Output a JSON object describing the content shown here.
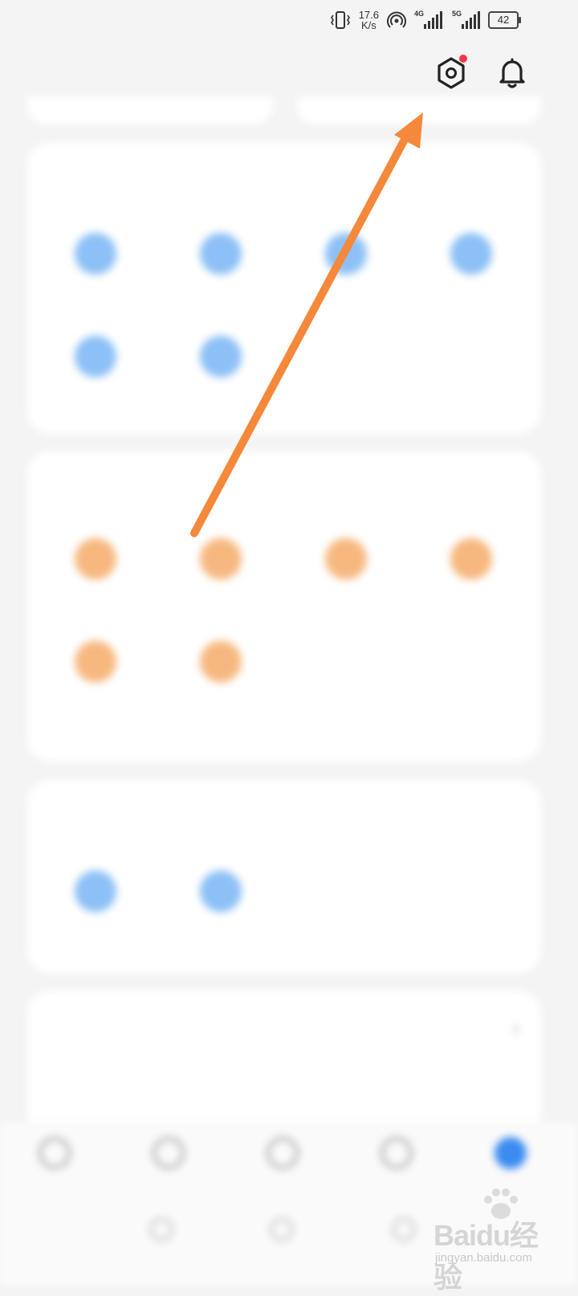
{
  "status_bar": {
    "time": "",
    "net_speed_value": "17.6",
    "net_speed_unit": "K/s",
    "signal1_tag": "4G",
    "signal2_tag": "5G",
    "battery": "42"
  },
  "header": {
    "settings_icon": "gear-icon",
    "settings_badge_color": "#f03a4b",
    "notifications_icon": "bell-icon"
  },
  "sections": [
    {
      "title": "",
      "items": [
        {
          "label": "",
          "icon_color": "#8cc0f6"
        },
        {
          "label": "",
          "icon_color": "#8cc0f6"
        },
        {
          "label": "",
          "icon_color": "#8cc0f6"
        },
        {
          "label": "",
          "icon_color": "#8cc0f6"
        },
        {
          "label": "",
          "icon_color": "#8cc0f6"
        },
        {
          "label": "",
          "icon_color": "#8cc0f6"
        }
      ]
    },
    {
      "title": "",
      "items": [
        {
          "label": "",
          "icon_color": "#f7b880"
        },
        {
          "label": "",
          "icon_color": "#f7b880"
        },
        {
          "label": "",
          "icon_color": "#f7b880"
        },
        {
          "label": "",
          "icon_color": "#f7b880"
        },
        {
          "label": "",
          "icon_color": "#f7b880"
        },
        {
          "label": "",
          "icon_color": "#f7b880"
        }
      ]
    },
    {
      "title": "",
      "items": [
        {
          "label": "",
          "icon_color": "#8cc0f6"
        },
        {
          "label": "",
          "icon_color": "#8cc0f6"
        }
      ]
    }
  ],
  "list_rows": [
    "",
    ""
  ],
  "bottom_nav": [
    "",
    "",
    "",
    "",
    ""
  ],
  "annotation": {
    "arrow_color": "#f5883a"
  },
  "watermark": {
    "brand": "Baidu经验",
    "url": "jingyan.baidu.com"
  }
}
